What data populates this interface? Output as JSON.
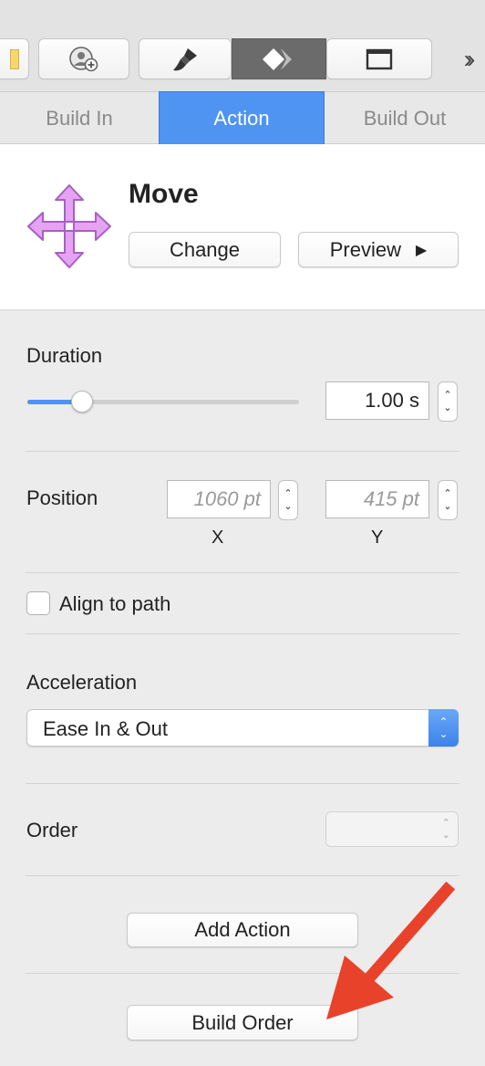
{
  "toolbar": {
    "items": [
      {
        "icon": "document-icon"
      },
      {
        "icon": "add-person-icon"
      },
      {
        "icon": "paintbrush-icon"
      },
      {
        "icon": "animate-diamond-icon",
        "selected": true
      },
      {
        "icon": "window-frame-icon"
      }
    ],
    "overflow": "››"
  },
  "tabs": [
    "Build In",
    "Action",
    "Build Out"
  ],
  "active_tab": "Action",
  "effect": {
    "name": "Move",
    "change_label": "Change",
    "preview_label": "Preview",
    "preview_glyph": "▶",
    "icon": "move-arrows-icon",
    "icon_color": "#c471e0"
  },
  "duration": {
    "label": "Duration",
    "value": "1.00 s",
    "slider_fraction": 0.2
  },
  "position": {
    "label": "Position",
    "x_placeholder": "1060 pt",
    "y_placeholder": "415 pt",
    "x_label": "X",
    "y_label": "Y"
  },
  "align_to_path": {
    "label": "Align to path",
    "checked": false
  },
  "acceleration": {
    "label": "Acceleration",
    "value": "Ease In & Out"
  },
  "order": {
    "label": "Order"
  },
  "buttons": {
    "add_action": "Add Action",
    "build_order": "Build Order"
  },
  "colors": {
    "accent": "#4e94f0",
    "annotation_arrow": "#e8432a"
  }
}
